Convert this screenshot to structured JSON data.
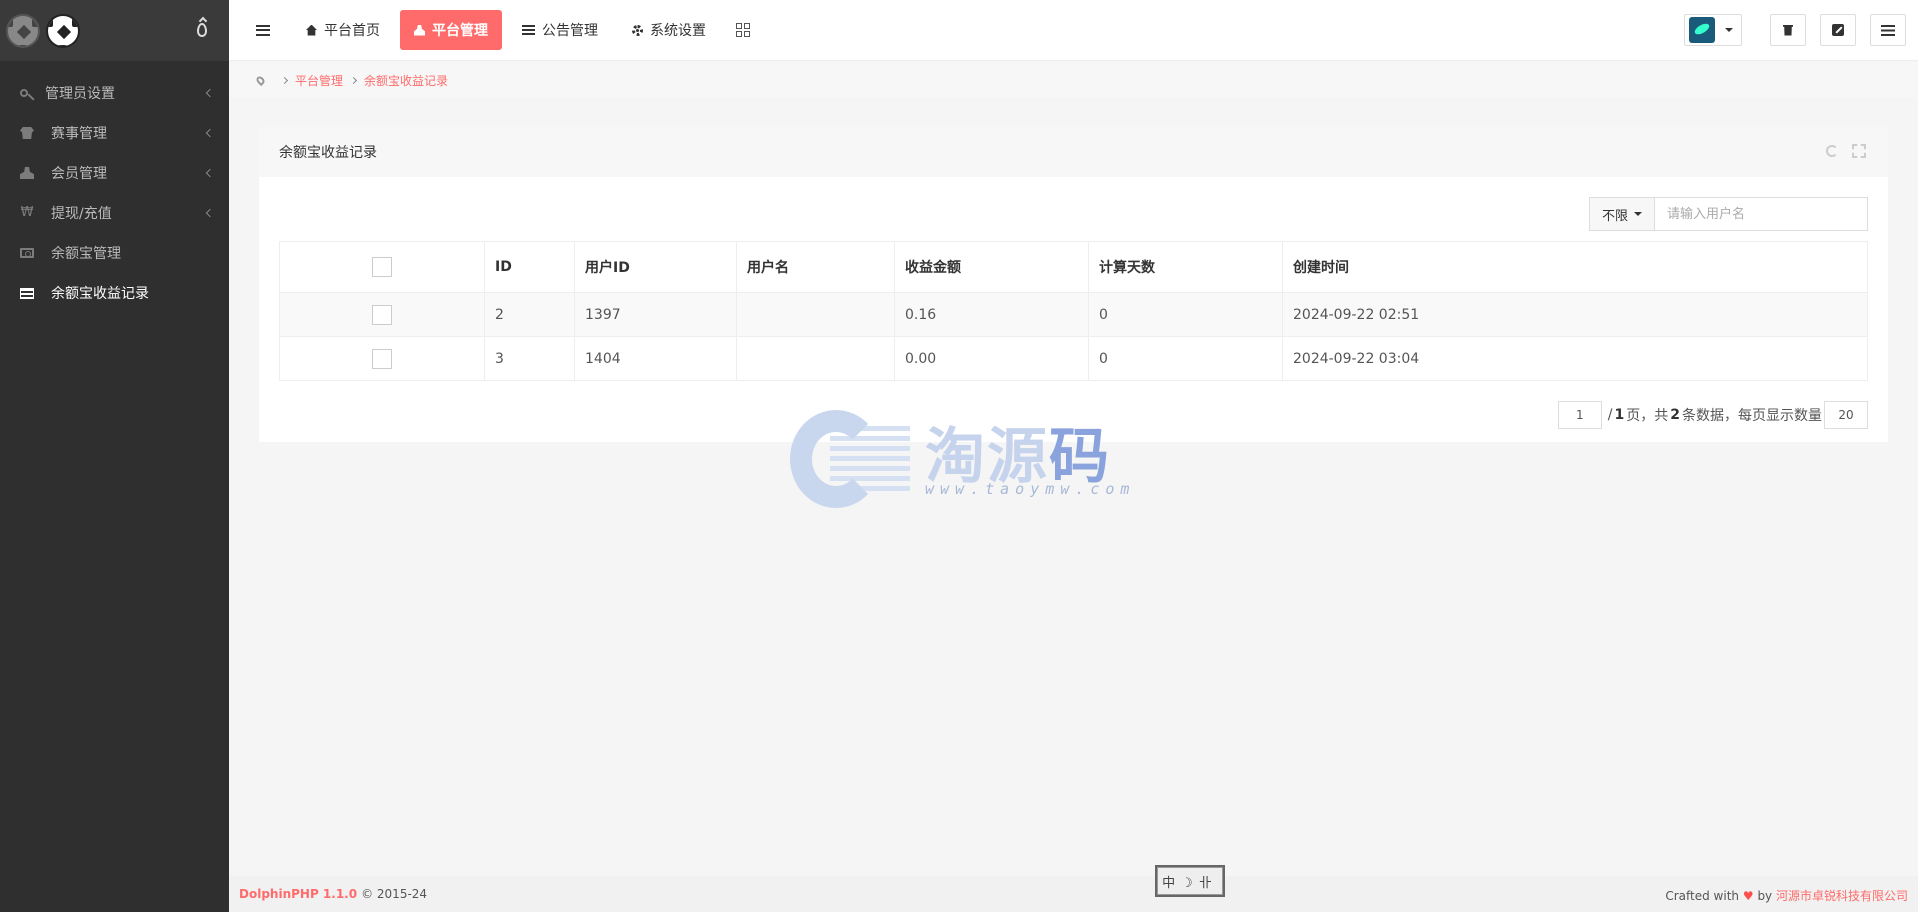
{
  "sidebar": {
    "items": [
      {
        "label": "管理员设置",
        "icon": "key-icon"
      },
      {
        "label": "赛事管理",
        "icon": "shirt-icon"
      },
      {
        "label": "会员管理",
        "icon": "user-icon"
      },
      {
        "label": "提现/充值",
        "icon": "won-icon"
      },
      {
        "label": "余额宝管理",
        "icon": "money-icon"
      },
      {
        "label": "余额宝收益记录",
        "icon": "list-icon"
      }
    ],
    "won_glyph": "₩"
  },
  "topbar": {
    "links": [
      {
        "label": "平台首页",
        "icon": "home-icon"
      },
      {
        "label": "平台管理",
        "icon": "user-icon"
      },
      {
        "label": "公告管理",
        "icon": "list-icon"
      },
      {
        "label": "系统设置",
        "icon": "gear-icon"
      }
    ],
    "accent": "#ff6b6b"
  },
  "breadcrumb": {
    "items": [
      "平台管理",
      "余额宝收益记录"
    ]
  },
  "panel": {
    "title": "余额宝收益记录",
    "filter_label": "不限",
    "search_placeholder": "请输入用户名",
    "columns": [
      "ID",
      "用户ID",
      "用户名",
      "收益金额",
      "计算天数",
      "创建时间"
    ],
    "rows": [
      {
        "id": "2",
        "user_id": "1397",
        "username": "",
        "amount": "0.16",
        "days": "0",
        "created": "2024-09-22 02:51"
      },
      {
        "id": "3",
        "user_id": "1404",
        "username": "",
        "amount": "0.00",
        "days": "0",
        "created": "2024-09-22 03:04"
      }
    ]
  },
  "pager": {
    "current_page": "1",
    "sep": "/",
    "total_pages": "1",
    "page_text": "页，共",
    "total_records": "2",
    "records_text": "条数据，每页显示数量",
    "page_size": "20"
  },
  "watermark": {
    "text_main": "淘源",
    "text_last": "码",
    "url": "www.taoymw.com"
  },
  "footer": {
    "brand": "DolphinPHP 1.1.0",
    "copyright": "© 2015-24",
    "crafted_with": "Crafted with",
    "heart": "♥",
    "by": "by",
    "company": "河源市卓锐科技有限公司",
    "stamp_text": "中☽卝"
  }
}
